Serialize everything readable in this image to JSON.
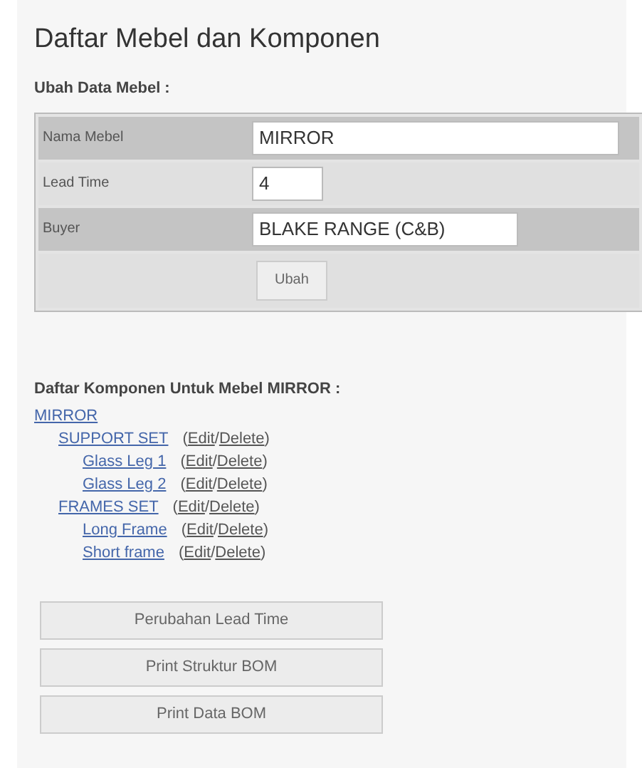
{
  "title": "Daftar Mebel dan Komponen",
  "form": {
    "heading": "Ubah Data Mebel :",
    "fields": [
      {
        "label": "Nama Mebel",
        "value": "MIRROR",
        "kind": "long"
      },
      {
        "label": "Lead Time",
        "value": "4",
        "kind": "short"
      },
      {
        "label": "Buyer",
        "value": "BLAKE RANGE (C&B)",
        "kind": "medium"
      }
    ],
    "submit": "Ubah"
  },
  "components": {
    "heading": "Daftar Komponen Untuk Mebel MIRROR :",
    "tree": [
      {
        "label": "MIRROR",
        "children": [
          {
            "label": "SUPPORT SET",
            "actions": [
              "(",
              "Edit",
              "/",
              "Delete",
              ")"
            ],
            "children": [
              {
                "label": "Glass Leg 1",
                "actions": [
                  "(",
                  "Edit",
                  "/",
                  "Delete",
                  ")"
                ]
              },
              {
                "label": "Glass Leg 2",
                "actions": [
                  "(",
                  "Edit",
                  "/",
                  "Delete",
                  ")"
                ]
              }
            ]
          },
          {
            "label": "FRAMES SET",
            "actions": [
              "(",
              "Edit",
              "/",
              "Delete",
              ")"
            ],
            "children": [
              {
                "label": "Long Frame",
                "actions": [
                  "(",
                  "Edit",
                  "/",
                  "Delete",
                  ")"
                ]
              },
              {
                "label": "Short frame",
                "actions": [
                  "(",
                  "Edit",
                  "/",
                  "Delete",
                  ")"
                ]
              }
            ]
          }
        ]
      }
    ]
  },
  "buttons": [
    "Perubahan Lead Time",
    "Print Struktur BOM",
    "Print Data BOM"
  ]
}
